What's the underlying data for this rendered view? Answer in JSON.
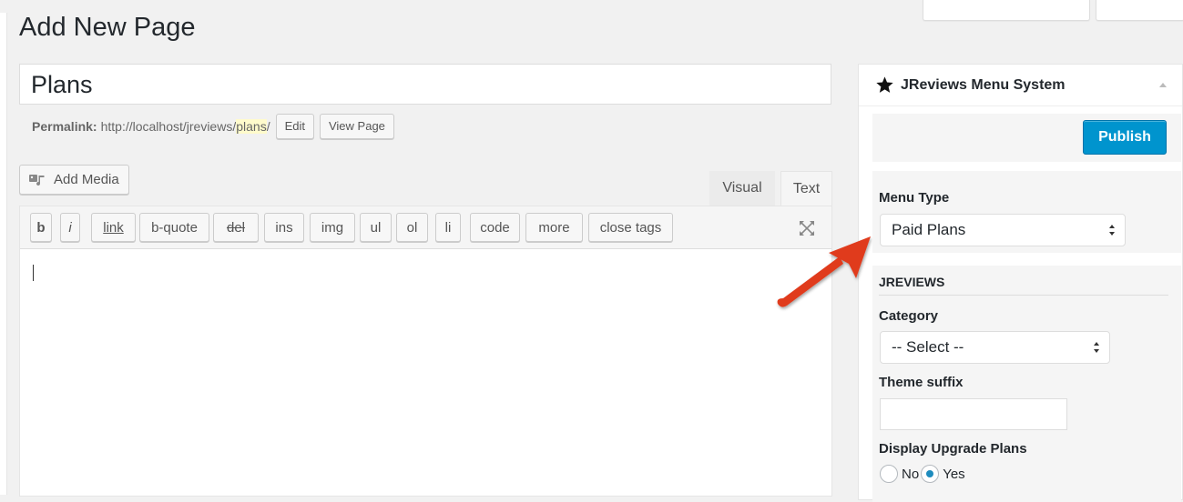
{
  "page": {
    "title": "Add New Page"
  },
  "post": {
    "title_value": "Plans",
    "permalink_label": "Permalink:",
    "permalink_base": "http://localhost/jreviews/",
    "permalink_slug": "plans",
    "permalink_trailing": "/",
    "edit_label": "Edit",
    "view_page_label": "View Page"
  },
  "editor": {
    "add_media_label": "Add Media",
    "tabs": {
      "visual": "Visual",
      "text": "Text"
    },
    "quicktags": [
      "b",
      "i",
      "link",
      "b-quote",
      "del",
      "ins",
      "img",
      "ul",
      "ol",
      "li",
      "code",
      "more",
      "close tags"
    ]
  },
  "metabox": {
    "title": "JReviews Menu System",
    "publish_label": "Publish",
    "menu_type_label": "Menu Type",
    "menu_type_value": "Paid Plans",
    "section_title": "JREVIEWS",
    "category_label": "Category",
    "category_value": "-- Select --",
    "theme_suffix_label": "Theme suffix",
    "theme_suffix_value": "",
    "display_upgrade_label": "Display Upgrade Plans",
    "radio_no": "No",
    "radio_yes": "Yes",
    "radio_selected": "Yes"
  },
  "colors": {
    "primary": "#0094ce",
    "arrow": "#e03a1e",
    "slug_highlight": "#fffbcc"
  }
}
